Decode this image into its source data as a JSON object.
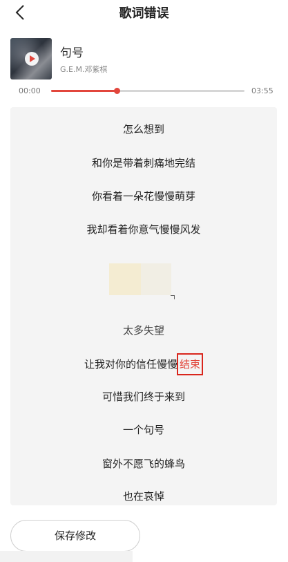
{
  "header": {
    "title": "歌词错误"
  },
  "song": {
    "name": "句号",
    "artist": "G.E.M.邓紫棋"
  },
  "player": {
    "current_time": "00:00",
    "total_time": "03:55",
    "progress": 0.34
  },
  "lyrics": {
    "lines": [
      "怎么想到",
      "和你是带着刺痛地完结",
      "你看着一朵花慢慢萌芽",
      "我却看着你意气慢慢风发",
      "太多失望",
      "让我对你的信任慢慢",
      "可惜我们终于来到",
      "一个句号",
      "窗外不愿飞的蜂鸟",
      "也在哀悼"
    ],
    "edited_word": "结束"
  },
  "actions": {
    "save_label": "保存修改"
  },
  "colors": {
    "accent": "#e2463c",
    "highlight_border": "#d9251c"
  }
}
